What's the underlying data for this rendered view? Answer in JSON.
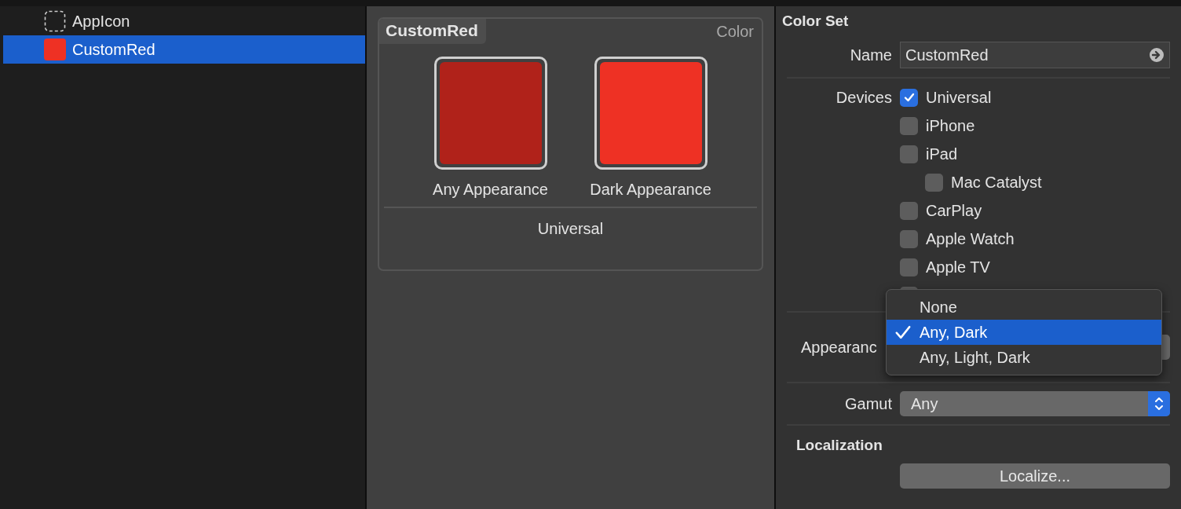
{
  "sidebar": {
    "items": [
      {
        "label": "AppIcon",
        "kind": "appicon",
        "selected": false
      },
      {
        "label": "CustomRed",
        "kind": "color",
        "color": "#ee3124",
        "selected": true
      }
    ]
  },
  "editor": {
    "title": "CustomRed",
    "type_label": "Color",
    "swatches": [
      {
        "label": "Any Appearance",
        "color": "#b0221a"
      },
      {
        "label": "Dark Appearance",
        "color": "#ee3124"
      }
    ],
    "device_label": "Universal"
  },
  "inspector": {
    "title": "Color Set",
    "name_label": "Name",
    "name_value": "CustomRed",
    "devices_label": "Devices",
    "devices": [
      {
        "label": "Universal",
        "checked": true
      },
      {
        "label": "iPhone",
        "checked": false
      },
      {
        "label": "iPad",
        "checked": false,
        "children": [
          {
            "label": "Mac Catalyst",
            "checked": false
          }
        ]
      },
      {
        "label": "CarPlay",
        "checked": false
      },
      {
        "label": "Apple Watch",
        "checked": false
      },
      {
        "label": "Apple TV",
        "checked": false
      }
    ],
    "appearance_label": "Appearanc",
    "appearance_menu": [
      {
        "label": "None",
        "selected": false
      },
      {
        "label": "Any, Dark",
        "selected": true
      },
      {
        "label": "Any, Light, Dark",
        "selected": false
      }
    ],
    "gamut_label": "Gamut",
    "gamut_value": "Any",
    "localization_title": "Localization",
    "localize_button": "Localize..."
  }
}
